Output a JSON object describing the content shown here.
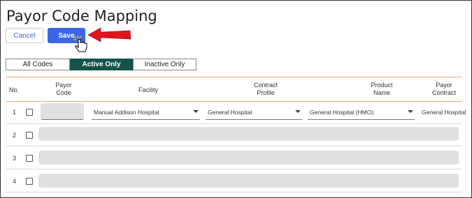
{
  "page": {
    "title": "Payor Code Mapping"
  },
  "toolbar": {
    "cancel_label": "Cancel",
    "save_label": "Save"
  },
  "filters": {
    "options": [
      "All Codes",
      "Active Only",
      "Inactive Only"
    ],
    "selected": "Active Only"
  },
  "table": {
    "columns": [
      "No.",
      "Payor Code",
      "Facility",
      "Contract Profile",
      "Product Name",
      "Payor Contract"
    ],
    "rows": [
      {
        "no": "1",
        "payor_code": "",
        "facility": "Manual Addison Hospital",
        "contract_profile": "General Hospital",
        "product_name": "General Hospital (HMO)",
        "payor_contract": "General Hospital"
      },
      {
        "no": "2"
      },
      {
        "no": "3"
      },
      {
        "no": "4"
      }
    ]
  },
  "colors": {
    "accent": "#3d66e6",
    "active_filter": "#15544d",
    "arrow": "#e0141e",
    "header_rule": "#e8a880"
  },
  "icons": {
    "arrow": "red-arrow-icon",
    "cursor": "hand-pointer-icon"
  }
}
